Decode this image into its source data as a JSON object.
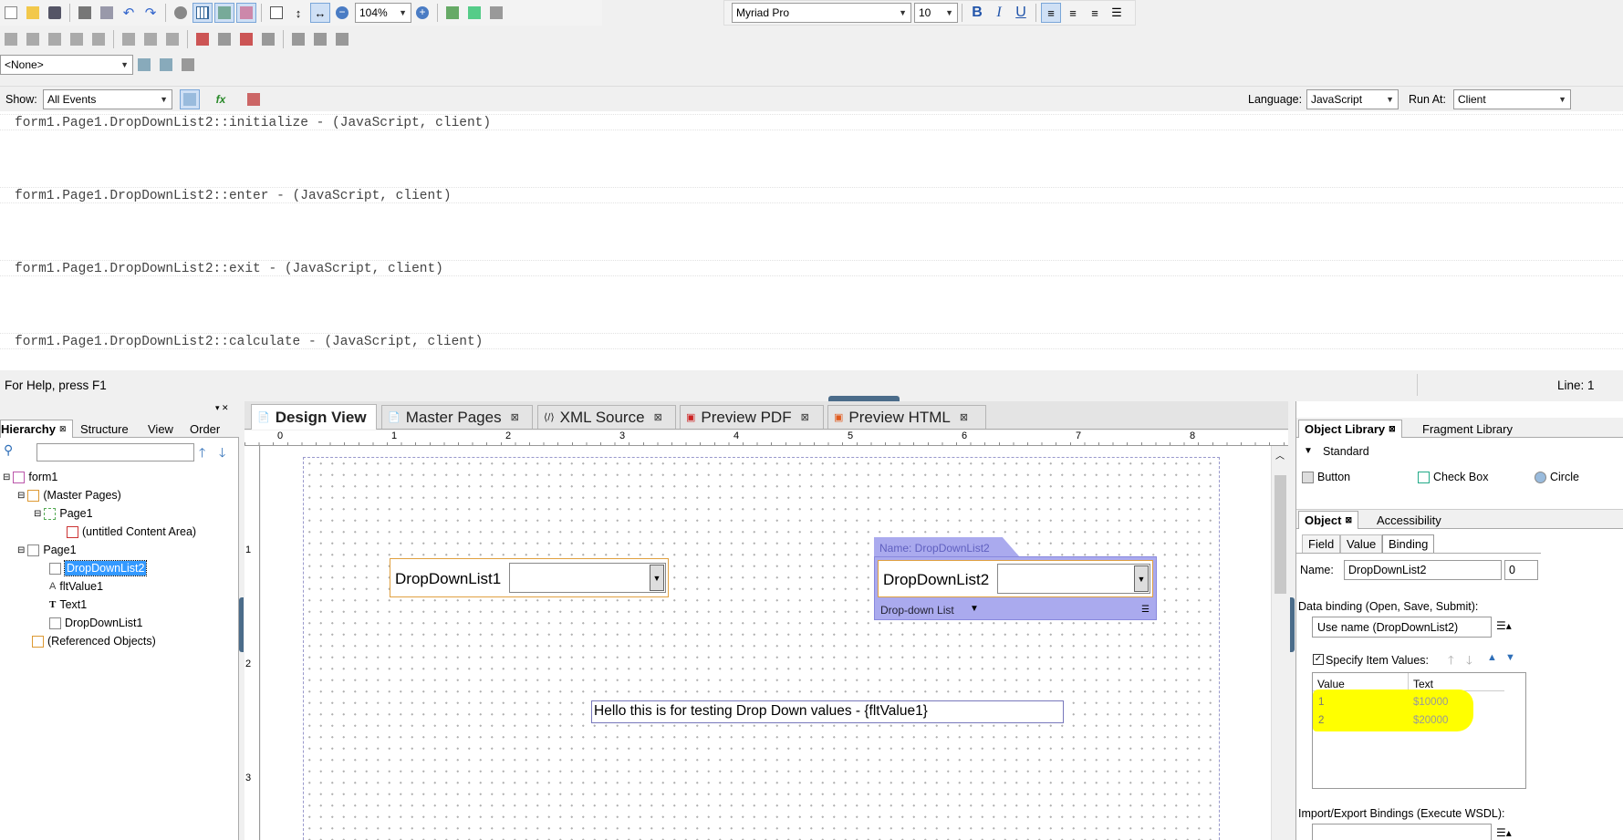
{
  "toolbar": {
    "zoom": "104%",
    "font": "Myriad Pro",
    "size": "10",
    "object_select": "<None>"
  },
  "script_bar": {
    "show_label": "Show:",
    "show_value": "All Events",
    "language_label": "Language:",
    "language_value": "JavaScript",
    "run_label": "Run At:",
    "run_value": "Client"
  },
  "script_lines": [
    "form1.Page1.DropDownList2::initialize - (JavaScript, client)",
    "form1.Page1.DropDownList2::enter - (JavaScript, client)",
    "form1.Page1.DropDownList2::exit - (JavaScript, client)",
    "form1.Page1.DropDownList2::calculate - (JavaScript, client)"
  ],
  "status": {
    "help": "For Help, press F1",
    "line": "Line: 1"
  },
  "left_panel": {
    "tabs": [
      "Hierarchy",
      "Structure",
      "View",
      "Order"
    ],
    "tree": [
      "form1",
      "(Master Pages)",
      "Page1",
      "(untitled Content Area)",
      "Page1",
      "DropDownList2",
      "fltValue1",
      "Text1",
      "DropDownList1",
      "(Referenced Objects)"
    ]
  },
  "center_tabs": [
    "Design View",
    "Master Pages",
    "XML Source",
    "Preview PDF",
    "Preview HTML"
  ],
  "ruler": [
    "0",
    "1",
    "2",
    "3",
    "4",
    "5",
    "6",
    "7",
    "8"
  ],
  "vruler": [
    "1",
    "2",
    "3"
  ],
  "canvas": {
    "ddl1_caption": "DropDownList1",
    "ddl2_caption": "DropDownList2",
    "name_tag": "Name: DropDownList2",
    "ddl2_type": "Drop-down List",
    "text_field": "Hello this is for testing Drop Down values - {fltValue1}"
  },
  "object_library": {
    "tabs": [
      "Object Library",
      "Fragment Library"
    ],
    "section": "Standard",
    "items": [
      "Button",
      "Check Box",
      "Circle"
    ]
  },
  "object_panel": {
    "tabs": [
      "Object",
      "Accessibility"
    ],
    "subtabs": [
      "Field",
      "Value",
      "Binding"
    ],
    "name_label": "Name:",
    "name_value": "DropDownList2",
    "name_index": "0",
    "binding_label": "Data binding (Open, Save, Submit):",
    "binding_value": "Use name (DropDownList2)",
    "specify_label": "Specify Item Values:",
    "col_value": "Value",
    "col_text": "Text",
    "rows": [
      {
        "value": "1",
        "text": "$10000"
      },
      {
        "value": "2",
        "text": "$20000"
      }
    ],
    "import_label": "Import/Export Bindings (Execute WSDL):"
  },
  "colors": {
    "accent": "#3399ff",
    "highlight": "#ffff00",
    "selection_purple": "#aaaaee",
    "field_orange": "#e0a040"
  }
}
